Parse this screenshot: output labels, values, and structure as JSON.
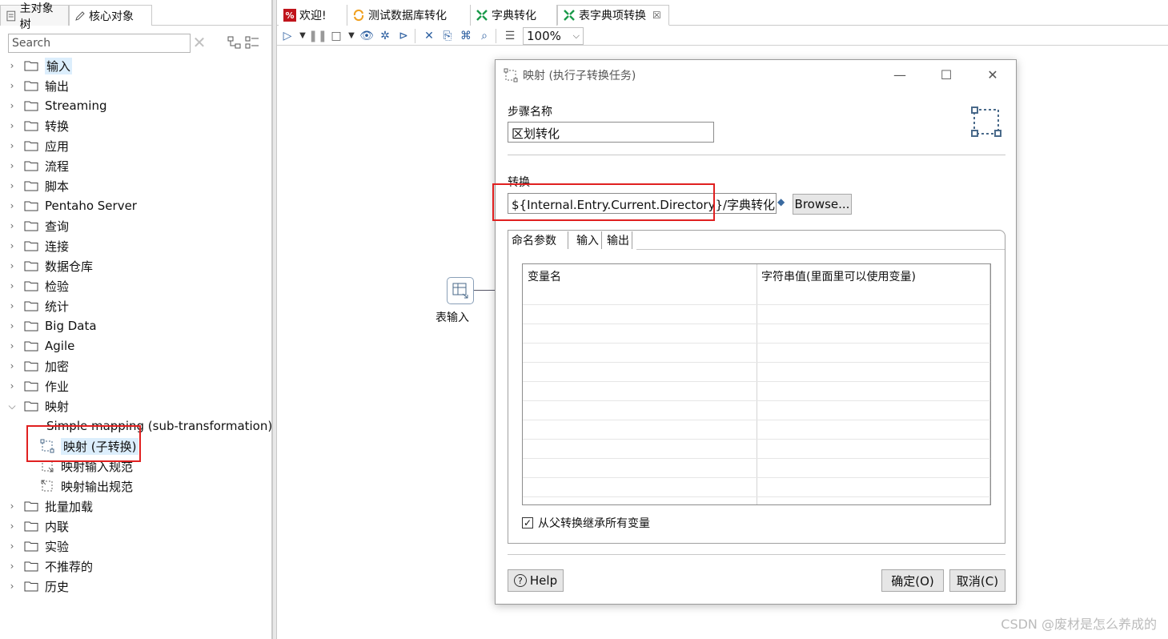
{
  "left_panel": {
    "tabs": [
      {
        "label": "主对象树",
        "icon": "document-icon"
      },
      {
        "label": "核心对象",
        "icon": "pencil-icon"
      }
    ],
    "search": {
      "placeholder": "Search"
    },
    "tree": [
      {
        "label": "输入",
        "expanded": false,
        "highlight": true
      },
      {
        "label": "输出",
        "expanded": false
      },
      {
        "label": "Streaming",
        "expanded": false
      },
      {
        "label": "转换",
        "expanded": false
      },
      {
        "label": "应用",
        "expanded": false
      },
      {
        "label": "流程",
        "expanded": false
      },
      {
        "label": "脚本",
        "expanded": false
      },
      {
        "label": "Pentaho Server",
        "expanded": false
      },
      {
        "label": "查询",
        "expanded": false
      },
      {
        "label": "连接",
        "expanded": false
      },
      {
        "label": "数据仓库",
        "expanded": false
      },
      {
        "label": "检验",
        "expanded": false
      },
      {
        "label": "统计",
        "expanded": false
      },
      {
        "label": "Big Data",
        "expanded": false
      },
      {
        "label": "Agile",
        "expanded": false
      },
      {
        "label": "加密",
        "expanded": false
      },
      {
        "label": "作业",
        "expanded": false
      },
      {
        "label": "映射",
        "expanded": true
      },
      {
        "label": "Simple mapping (sub-transformation)",
        "sub": true
      },
      {
        "label": "映射 (子转换)",
        "sub": true,
        "selected": true
      },
      {
        "label": "映射输入规范",
        "sub": true
      },
      {
        "label": "映射输出规范",
        "sub": true
      },
      {
        "label": "批量加载",
        "expanded": false
      },
      {
        "label": "内联",
        "expanded": false
      },
      {
        "label": "实验",
        "expanded": false
      },
      {
        "label": "不推荐的",
        "expanded": false
      },
      {
        "label": "历史",
        "expanded": false
      }
    ]
  },
  "editor": {
    "tabs": [
      {
        "label": "欢迎!",
        "icon": "welcome-icon"
      },
      {
        "label": "测试数据库转化",
        "icon": "transformation-icon"
      },
      {
        "label": "字典转化",
        "icon": "transformation-icon"
      },
      {
        "label": "表字典项转换",
        "icon": "transformation-icon",
        "active": true,
        "close": "☒"
      }
    ],
    "zoom": "100%",
    "canvas": {
      "step_label": "表输入"
    },
    "watermark": "CSDN @废材是怎么养成的"
  },
  "dialog": {
    "title": "映射 (执行子转换任务)",
    "step_name_label": "步骤名称",
    "step_name_value": "区划转化",
    "transformation_label": "转换",
    "transformation_value": "${Internal.Entry.Current.Directory}/字典转化.ktr",
    "browse_label": "Browse...",
    "tabs": [
      "命名参数",
      "输入",
      "输出"
    ],
    "table": {
      "columns": [
        "变量名",
        "字符串值(里面里可以使用变量)"
      ],
      "rows": []
    },
    "inherit_label": "从父转换继承所有变量",
    "inherit_checked": true,
    "help_label": "Help",
    "ok_label": "确定(O)",
    "cancel_label": "取消(C)"
  },
  "colors": {
    "highlight_red": "#e02020",
    "selection_blue": "#dceefc"
  }
}
